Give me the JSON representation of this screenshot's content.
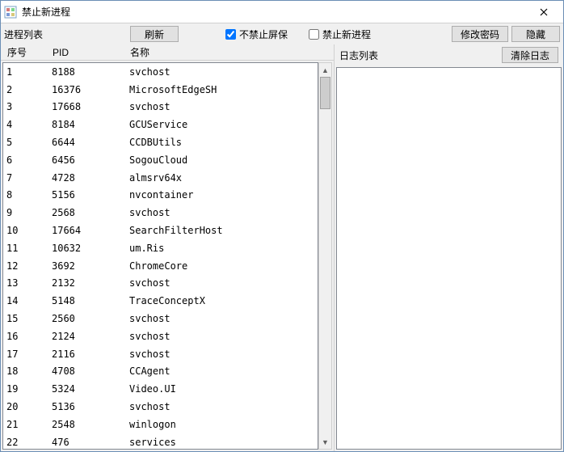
{
  "window": {
    "title": "禁止新进程"
  },
  "toolbar": {
    "process_list_label": "进程列表",
    "refresh_label": "刷新",
    "allow_screensaver_label": "不禁止屏保",
    "allow_screensaver_checked": true,
    "block_new_process_label": "禁止新进程",
    "block_new_process_checked": false,
    "change_password_label": "修改密码",
    "hide_label": "隐藏"
  },
  "columns": {
    "seq": "序号",
    "pid": "PID",
    "name": "名称"
  },
  "processes": [
    {
      "seq": "1",
      "pid": "8188",
      "name": "svchost"
    },
    {
      "seq": "2",
      "pid": "16376",
      "name": "MicrosoftEdgeSH"
    },
    {
      "seq": "3",
      "pid": "17668",
      "name": "svchost"
    },
    {
      "seq": "4",
      "pid": "8184",
      "name": "GCUService"
    },
    {
      "seq": "5",
      "pid": "6644",
      "name": "CCDBUtils"
    },
    {
      "seq": "6",
      "pid": "6456",
      "name": "SogouCloud"
    },
    {
      "seq": "7",
      "pid": "4728",
      "name": "almsrv64x"
    },
    {
      "seq": "8",
      "pid": "5156",
      "name": "nvcontainer"
    },
    {
      "seq": "9",
      "pid": "2568",
      "name": "svchost"
    },
    {
      "seq": "10",
      "pid": "17664",
      "name": "SearchFilterHost"
    },
    {
      "seq": "11",
      "pid": "10632",
      "name": "um.Ris"
    },
    {
      "seq": "12",
      "pid": "3692",
      "name": "ChromeCore"
    },
    {
      "seq": "13",
      "pid": "2132",
      "name": "svchost"
    },
    {
      "seq": "14",
      "pid": "5148",
      "name": "TraceConceptX"
    },
    {
      "seq": "15",
      "pid": "2560",
      "name": "svchost"
    },
    {
      "seq": "16",
      "pid": "2124",
      "name": "svchost"
    },
    {
      "seq": "17",
      "pid": "2116",
      "name": "svchost"
    },
    {
      "seq": "18",
      "pid": "4708",
      "name": "CCAgent"
    },
    {
      "seq": "19",
      "pid": "5324",
      "name": "Video.UI"
    },
    {
      "seq": "20",
      "pid": "5136",
      "name": "svchost"
    },
    {
      "seq": "21",
      "pid": "2548",
      "name": "winlogon"
    },
    {
      "seq": "22",
      "pid": "476",
      "name": "services"
    }
  ],
  "log_panel": {
    "label": "日志列表",
    "clear_label": "清除日志"
  }
}
